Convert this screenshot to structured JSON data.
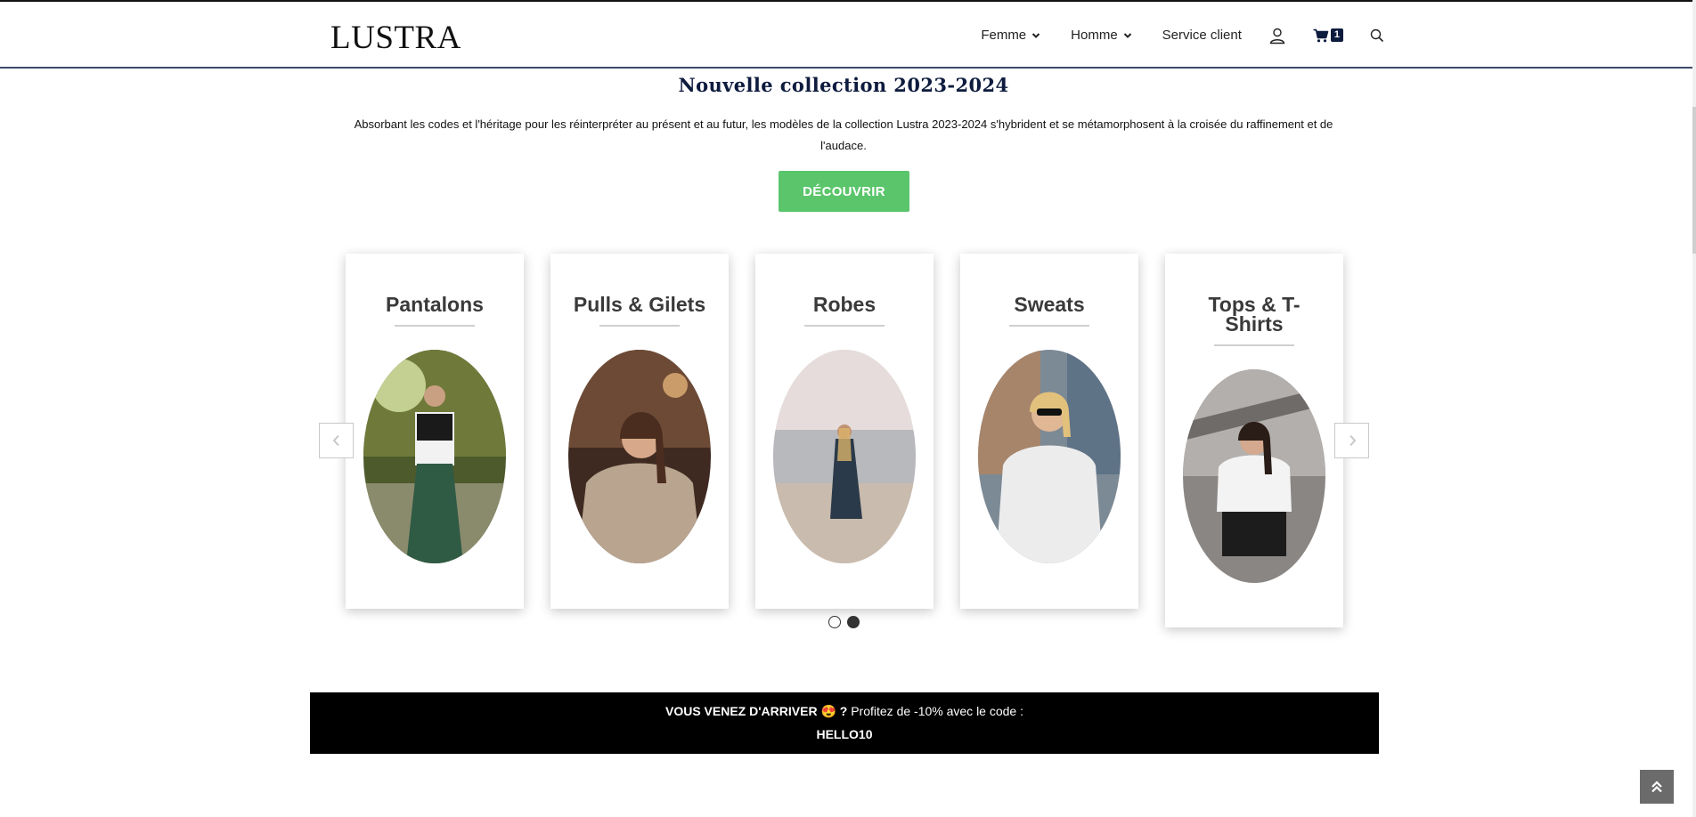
{
  "brand": {
    "logo_text": "LUSTRA"
  },
  "nav": {
    "items": [
      {
        "label": "Femme",
        "has_dropdown": true
      },
      {
        "label": "Homme",
        "has_dropdown": true
      },
      {
        "label": "Service client",
        "has_dropdown": false
      }
    ],
    "account_icon": "user-icon",
    "cart_icon": "cart-icon",
    "cart_count": "1",
    "search_icon": "search-icon"
  },
  "hero": {
    "title": "Nouvelle collection 2023-2024",
    "text": "Absorbant les codes et l'héritage pour les réinterpréter au présent et au futur, les modèles de la collection Lustra 2023-2024 s'hybrident et se métamorphosent à la croisée du raffinement et de l'audace.",
    "cta_label": "DÉCOUVRIR"
  },
  "categories": [
    {
      "title": "Pantalons"
    },
    {
      "title": "Pulls & Gilets"
    },
    {
      "title": "Robes"
    },
    {
      "title": "Sweats"
    },
    {
      "title": "Tops & T-Shirts"
    }
  ],
  "carousel": {
    "pages": 2,
    "active_page": 2
  },
  "promo": {
    "strong_text": "VOUS VENEZ D'ARRIVER 😍 ?",
    "text": " Profitez de -10% avec le code :",
    "code": "HELLO10"
  },
  "colors": {
    "navy": "#0d1b3e",
    "cta_green": "#5bc56b",
    "promo_bg": "#000000"
  }
}
